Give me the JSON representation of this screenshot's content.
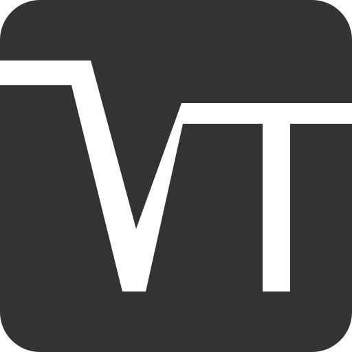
{
  "icon": {
    "name": "vt-logo-icon",
    "monogram": "VT",
    "background_color": "#333333",
    "glyph_color": "#ffffff",
    "canvas_color": "#ffffff"
  }
}
